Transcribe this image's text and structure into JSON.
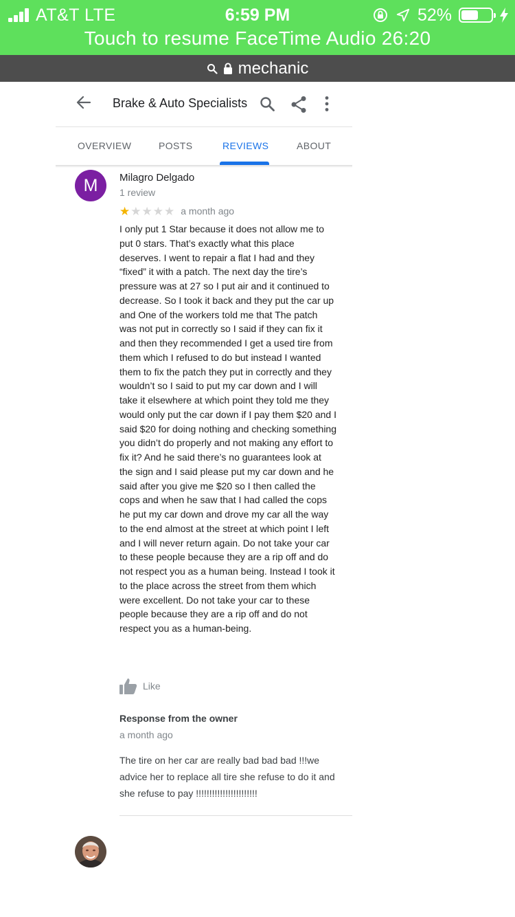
{
  "status_bar": {
    "carrier": "AT&T  LTE",
    "time": "6:59 PM",
    "battery": "52%",
    "battery_level": 0.52,
    "banner": "Touch to resume FaceTime Audio 26:20"
  },
  "url_bar": {
    "text": "mechanic"
  },
  "header": {
    "title": "Brake & Auto Specialists"
  },
  "tabs": [
    {
      "label": "OVERVIEW"
    },
    {
      "label": "POSTS"
    },
    {
      "label": "REVIEWS",
      "active": true
    },
    {
      "label": "ABOUT"
    }
  ],
  "review": {
    "avatar_initial": "M",
    "avatar_color": "#7b1fa2",
    "name": "Milagro Delgado",
    "count": "1 review",
    "rating": 1,
    "max_rating": 5,
    "date": "a month ago",
    "text": "I only put 1 Star because it does not allow me to put 0 stars. That’s exactly what this place deserves. I went to repair a flat I had and they “fixed” it with a patch. The next day the tire’s pressure was at 27 so I put air and it continued to decrease. So I took it back and they put the car up and  One of the workers told me that The patch was not put in correctly so I said if they can fix it and then they recommended I get a used tire from them which I refused to do but instead I wanted them to fix the patch they put in correctly and they wouldn’t so I said to put my car down and I will take it elsewhere at which point they told me they would only put the car down if I pay them $20 and I said $20 for  doing nothing and checking something you didn’t do properly and not making any effort to fix it? And he said there’s no guarantees look at the sign and I said please put my car down and he said after you give me $20 so I then called the cops and when he saw that I had called the cops he put my car down and drove my car all the way to the end almost at the street at which point I left and I will never return again. Do not take your car to these people because they are a rip off and do not respect you as a human being.  Instead I took it to the place across the street from them which were excellent. Do not take your car to these people because they are a rip off and do not respect you as a human-being.",
    "like_label": "Like"
  },
  "owner_response": {
    "title": "Response from the owner",
    "date": "a month ago",
    "text": "The tire on her car are really bad bad bad !!!we advice her to replace all tire she refuse to do it and she refuse to pay !!!!!!!!!!!!!!!!!!!!!!!"
  },
  "colors": {
    "status_green": "#5ee05c",
    "accent_blue": "#1a73e8",
    "star_gold": "#f4b400"
  }
}
